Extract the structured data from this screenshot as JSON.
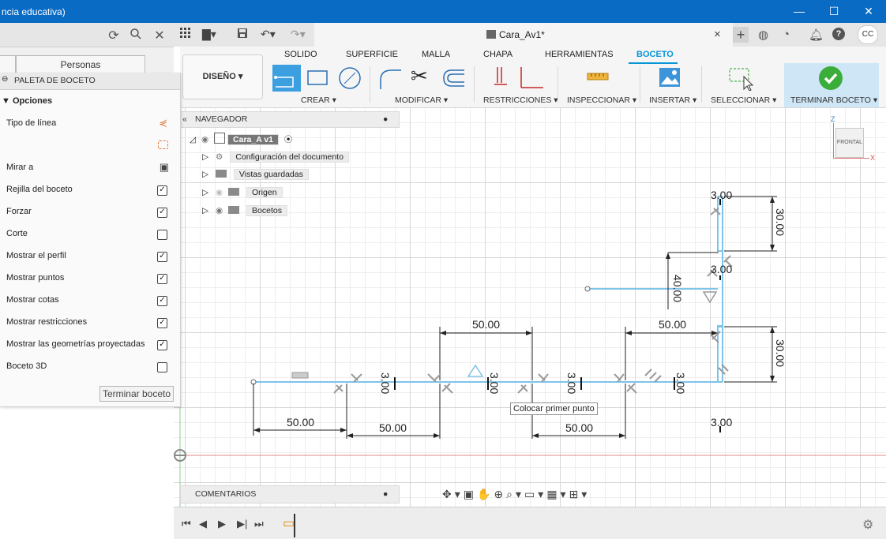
{
  "window": {
    "title": "ncia educativa)",
    "minimize": "—",
    "maximize": "☐",
    "close": "✕"
  },
  "data_panel": {
    "tab_label": "Personas"
  },
  "palette": {
    "header": "PALETA DE BOCETO",
    "section": "▼ Opciones",
    "rows": [
      {
        "label": "Tipo de línea",
        "control": "linetype-icon"
      },
      {
        "label": "",
        "control": "construction-icon"
      },
      {
        "label": "Mirar a",
        "control": "look-at-icon"
      },
      {
        "label": "Rejilla del boceto",
        "checked": "✓"
      },
      {
        "label": "Forzar",
        "checked": "✓"
      },
      {
        "label": "Corte",
        "checked": ""
      },
      {
        "label": "Mostrar el perfil",
        "checked": "✓"
      },
      {
        "label": "Mostrar puntos",
        "checked": "✓"
      },
      {
        "label": "Mostrar cotas",
        "checked": "✓"
      },
      {
        "label": "Mostrar restricciones",
        "checked": "✓"
      },
      {
        "label": "Mostrar las geometrías proyectadas",
        "checked": "✓"
      },
      {
        "label": "Boceto 3D",
        "checked": ""
      }
    ],
    "finish_button": "Terminar boceto"
  },
  "document": {
    "tab_title": "Cara_Av1*",
    "close": "×",
    "user_initials": "CC"
  },
  "ribbon": {
    "tabs": [
      "SOLIDO",
      "SUPERFICIE",
      "MALLA",
      "CHAPA",
      "HERRAMIENTAS",
      "BOCETO"
    ],
    "active_tab": "BOCETO",
    "active_color": "#0696d7",
    "workspace_button": "DISEÑO ▾",
    "groups": [
      "CREAR ▾",
      "MODIFICAR ▾",
      "RESTRICCIONES ▾",
      "INSPECCIONAR ▾",
      "INSERTAR ▾",
      "SELECCIONAR ▾",
      "TERMINAR BOCETO ▾"
    ]
  },
  "navigator": {
    "header": "NAVEGADOR",
    "root": "Cara_A v1",
    "items": [
      "Configuración del documento",
      "Vistas guardadas",
      "Origen",
      "Bocetos"
    ]
  },
  "comments": {
    "header": "COMENTARIOS"
  },
  "viewcube": {
    "face": "FRONTAL",
    "z": "Z",
    "x": "X"
  },
  "sketch": {
    "dimensions": {
      "h1": "50.00",
      "h2": "50.00",
      "h3": "50.00",
      "h4": "50.00",
      "h5": "50.00",
      "h6": "50.00",
      "v_top": "30.00",
      "v_mid": "30.00",
      "v_40": "40.00",
      "t_top": "3.00",
      "t_mid": "3.00",
      "t_bot": "3.00",
      "t1": "3.00",
      "t2": "3.00",
      "t3": "3.00",
      "t4": "3.00"
    },
    "tooltip": "Colocar primer punto",
    "line_color": "#7ec3ea"
  }
}
